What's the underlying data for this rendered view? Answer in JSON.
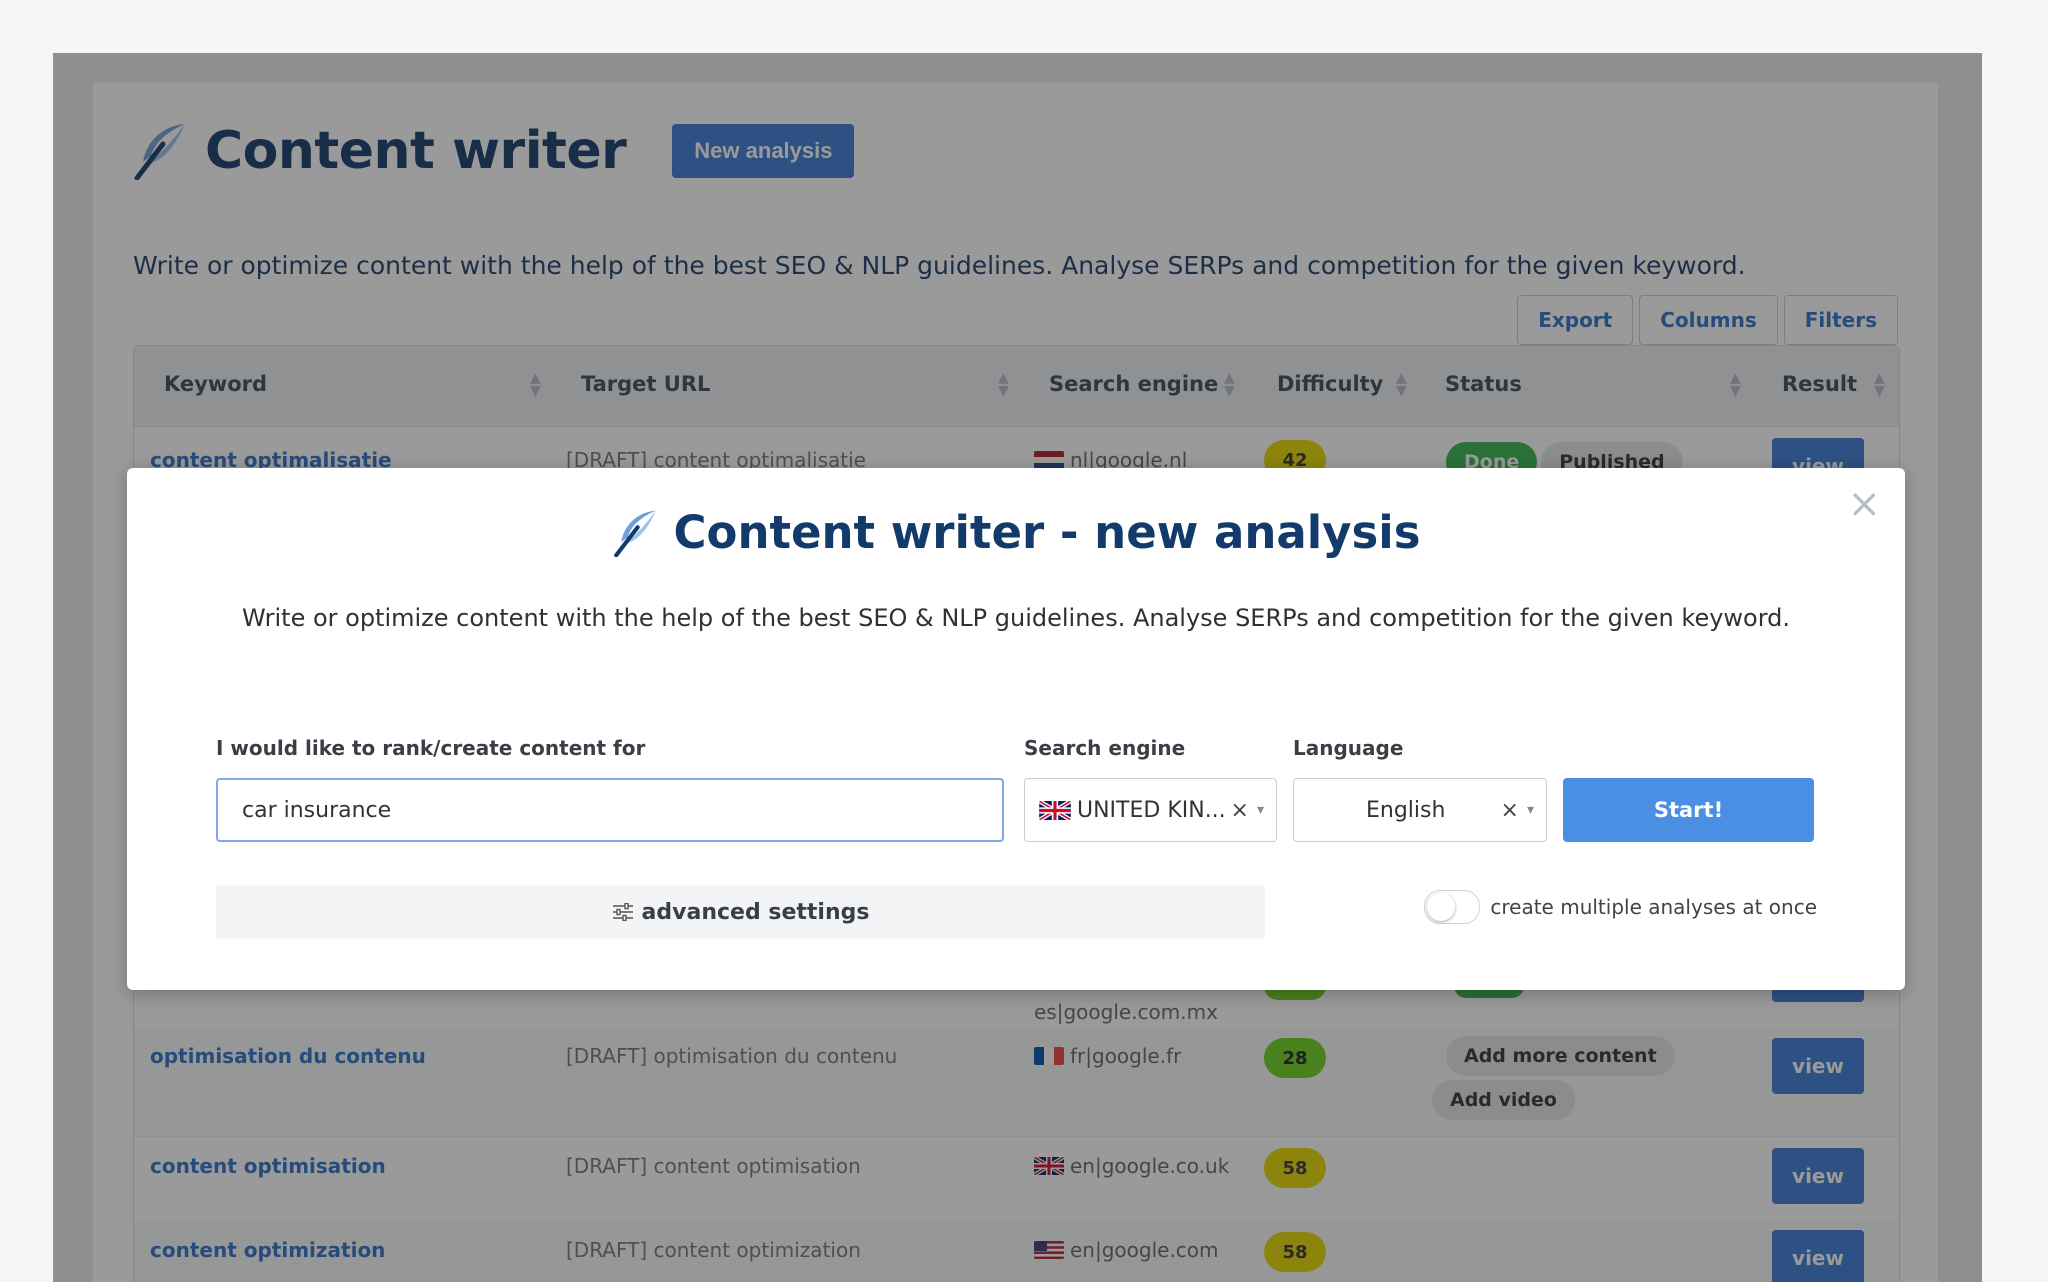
{
  "page": {
    "title": "Content writer",
    "new_analysis_label": "New analysis",
    "subtitle": "Write or optimize content with the help of the best SEO & NLP guidelines. Analyse SERPs and competition for the given keyword.",
    "toolbar": {
      "export": "Export",
      "columns": "Columns",
      "filters": "Filters"
    }
  },
  "table": {
    "headers": {
      "keyword": "Keyword",
      "target_url": "Target URL",
      "search_engine": "Search engine",
      "difficulty": "Difficulty",
      "status": "Status",
      "result": "Result"
    },
    "rows": [
      {
        "keyword": "content optimalisatie",
        "url": "[DRAFT] content optimalisatie",
        "engine": "nl|google.nl",
        "flag": "nl",
        "difficulty": "42",
        "statuses": [
          "Done",
          "Published"
        ],
        "view": "view"
      },
      {
        "keyword": "",
        "url": "",
        "engine": "es|google.com.mx",
        "flag": "",
        "difficulty": "",
        "statuses": [],
        "view": ""
      },
      {
        "keyword": "optimisation du contenu",
        "url": "[DRAFT] optimisation du contenu",
        "engine": "fr|google.fr",
        "flag": "fr",
        "difficulty": "28",
        "statuses": [
          "Add more content",
          "Add video"
        ],
        "view": "view"
      },
      {
        "keyword": "content optimisation",
        "url": "[DRAFT] content optimisation",
        "engine": "en|google.co.uk",
        "flag": "uk",
        "difficulty": "58",
        "statuses": [],
        "view": "view"
      },
      {
        "keyword": "content optimization",
        "url": "[DRAFT] content optimization",
        "engine": "en|google.com",
        "flag": "us",
        "difficulty": "58",
        "statuses": [],
        "view": "view"
      }
    ]
  },
  "modal": {
    "title": "Content writer - new analysis",
    "subtitle": "Write or optimize content with the help of the best SEO & NLP guidelines. Analyse SERPs and competition for the given keyword.",
    "keyword_label": "I would like to rank/create content for",
    "keyword_value": "car insurance",
    "engine_label": "Search engine",
    "engine_value": "UNITED KIN...",
    "language_label": "Language",
    "language_value": "English",
    "clear_glyph": "×",
    "caret_glyph": "▾",
    "start_label": "Start!",
    "advanced_label": "advanced settings",
    "multiple_label": "create multiple analyses at once",
    "multiple_enabled": false,
    "close_glyph": "×"
  },
  "colors": {
    "brand_navy": "#123a6b",
    "primary_blue": "#3a7bd5",
    "done_green": "#34b24c",
    "difficulty_yellow": "#e7d800",
    "difficulty_green": "#6cd21e"
  }
}
